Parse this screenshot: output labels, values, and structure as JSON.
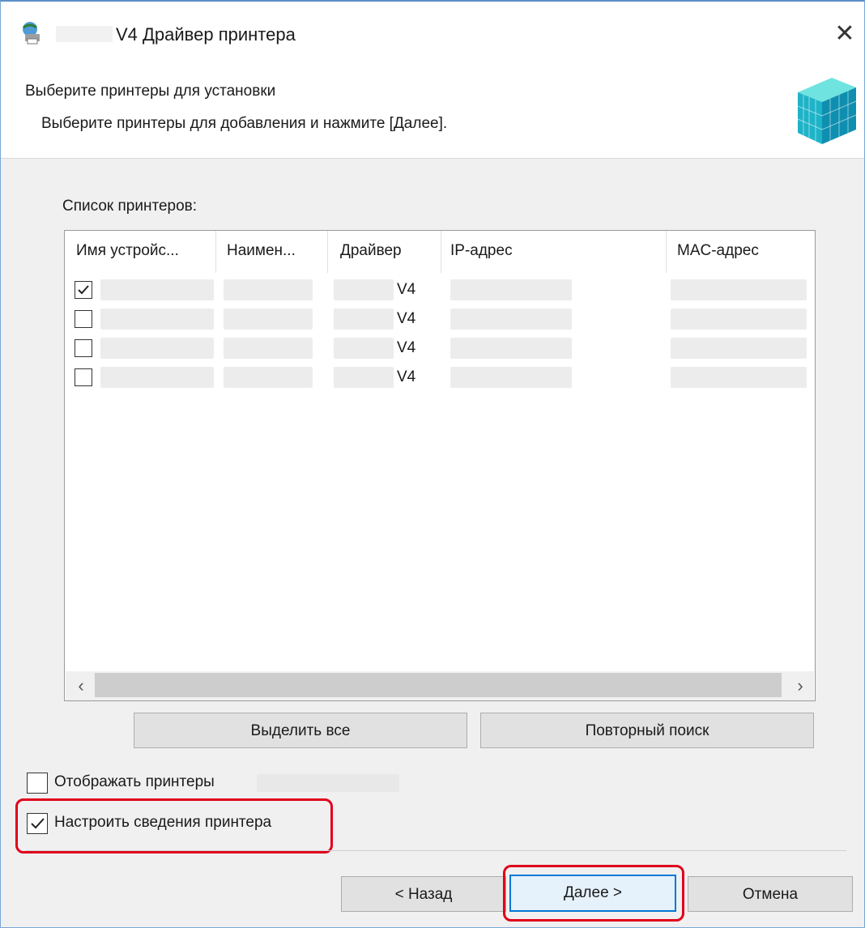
{
  "window": {
    "title": "V4 Драйвер принтера",
    "close_glyph": "✕",
    "icon": "printer-globe-icon"
  },
  "header": {
    "heading": "Выберите принтеры для установки",
    "subheading": "Выберите принтеры для добавления и нажмите [Далее]."
  },
  "list": {
    "label": "Список принтеров:",
    "columns": [
      "Имя устройс...",
      "Наимен...",
      "Драйвер",
      "IP-адрес",
      "MAC-адрес"
    ],
    "rows": [
      {
        "checked": true,
        "driver": "V4"
      },
      {
        "checked": false,
        "driver": "V4"
      },
      {
        "checked": false,
        "driver": "V4"
      },
      {
        "checked": false,
        "driver": "V4"
      }
    ],
    "scroll_left": "‹",
    "scroll_right": "›"
  },
  "buttons": {
    "select_all": "Выделить все",
    "search_again": "Повторный поиск",
    "back": "< Назад",
    "next": "Далее >",
    "cancel": "Отмена"
  },
  "options": {
    "show_printers": {
      "label": "Отображать принтеры",
      "checked": false
    },
    "configure_info": {
      "label": "Настроить сведения принтера",
      "checked": true
    }
  },
  "colors": {
    "highlight": "#e0001b",
    "focus": "#0078d7"
  }
}
